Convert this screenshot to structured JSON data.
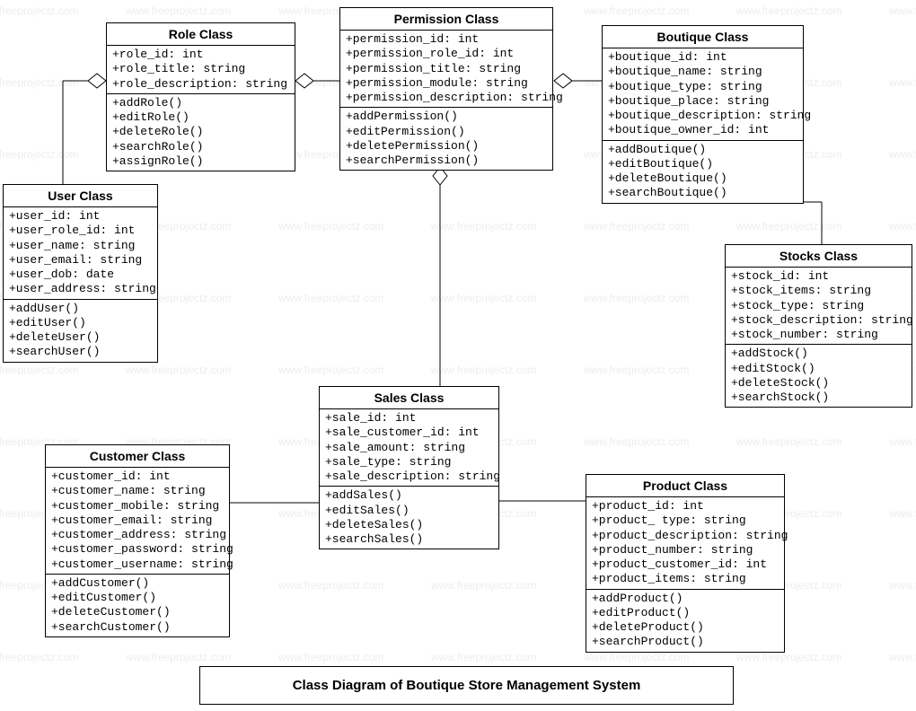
{
  "caption": "Class Diagram of Boutique Store Management System",
  "watermark": "www.freeprojectz.com",
  "classes": {
    "role": {
      "title": "Role Class",
      "attrs": [
        "+role_id: int",
        "+role_title: string",
        "+role_description: string"
      ],
      "ops": [
        "+addRole()",
        "+editRole()",
        "+deleteRole()",
        "+searchRole()",
        "+assignRole()"
      ]
    },
    "permission": {
      "title": "Permission Class",
      "attrs": [
        "+permission_id: int",
        "+permission_role_id: int",
        "+permission_title: string",
        "+permission_module: string",
        "+permission_description: string"
      ],
      "ops": [
        "+addPermission()",
        "+editPermission()",
        "+deletePermission()",
        "+searchPermission()"
      ]
    },
    "boutique": {
      "title": "Boutique Class",
      "attrs": [
        "+boutique_id: int",
        "+boutique_name: string",
        "+boutique_type: string",
        "+boutique_place: string",
        "+boutique_description: string",
        "+boutique_owner_id: int"
      ],
      "ops": [
        "+addBoutique()",
        "+editBoutique()",
        "+deleteBoutique()",
        "+searchBoutique()"
      ]
    },
    "user": {
      "title": "User Class",
      "attrs": [
        "+user_id: int",
        "+user_role_id: int",
        "+user_name: string",
        "+user_email: string",
        "+user_dob: date",
        "+user_address: string"
      ],
      "ops": [
        "+addUser()",
        "+editUser()",
        "+deleteUser()",
        "+searchUser()"
      ]
    },
    "stocks": {
      "title": "Stocks Class",
      "attrs": [
        "+stock_id: int",
        "+stock_items: string",
        "+stock_type: string",
        "+stock_description: string",
        "+stock_number: string"
      ],
      "ops": [
        "+addStock()",
        "+editStock()",
        "+deleteStock()",
        "+searchStock()"
      ]
    },
    "sales": {
      "title": "Sales Class",
      "attrs": [
        "+sale_id: int",
        "+sale_customer_id: int",
        "+sale_amount: string",
        "+sale_type: string",
        "+sale_description: string"
      ],
      "ops": [
        "+addSales()",
        "+editSales()",
        "+deleteSales()",
        "+searchSales()"
      ]
    },
    "customer": {
      "title": "Customer Class",
      "attrs": [
        "+customer_id: int",
        "+customer_name: string",
        "+customer_mobile: string",
        "+customer_email: string",
        "+customer_address: string",
        "+customer_password: string",
        "+customer_username: string"
      ],
      "ops": [
        "+addCustomer()",
        "+editCustomer()",
        "+deleteCustomer()",
        "+searchCustomer()"
      ]
    },
    "product": {
      "title": "Product Class",
      "attrs": [
        "+product_id: int",
        "+product_ type: string",
        "+product_description: string",
        "+product_number: string",
        "+product_customer_id: int",
        "+product_items: string"
      ],
      "ops": [
        "+addProduct()",
        "+editProduct()",
        "+deleteProduct()",
        "+searchProduct()"
      ]
    }
  }
}
